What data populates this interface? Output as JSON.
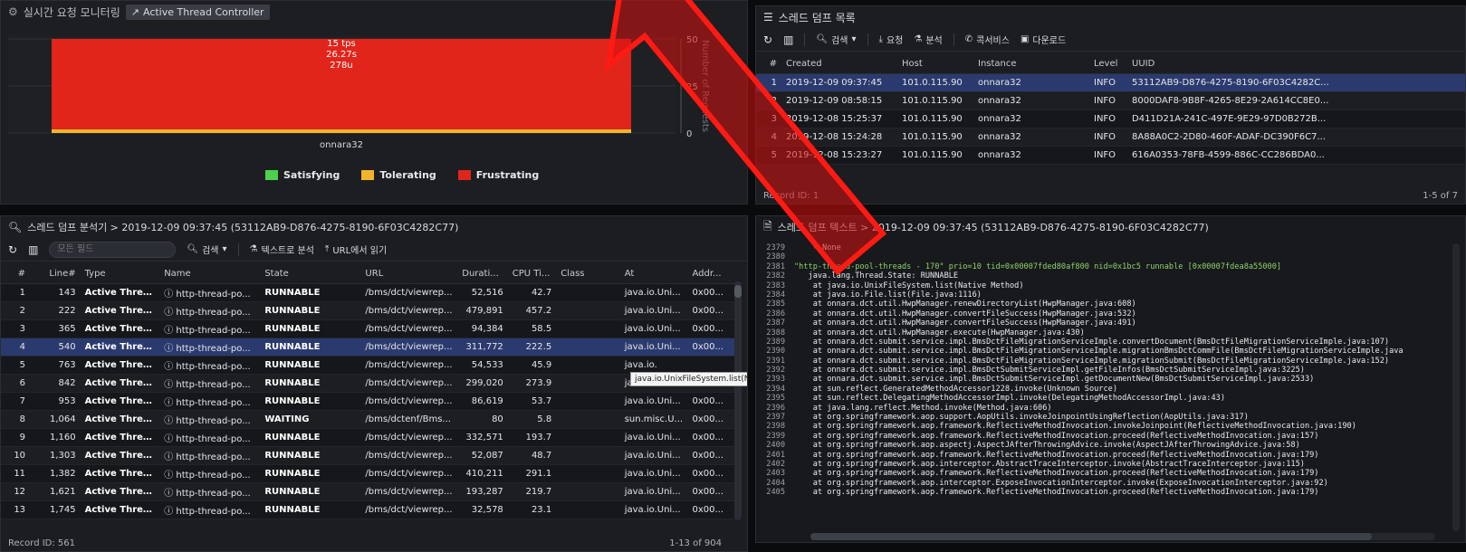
{
  "monitor": {
    "title": "실시간 요청 모니터링",
    "controller_button": "Active Thread Controller",
    "chart_label_rate": "15 tps",
    "chart_label_time": "26.27s",
    "chart_label_users": "278u",
    "chart_category": "onnara32",
    "chart_ylabel": "Number of Requests",
    "legend": [
      "Satisfying",
      "Tolerating",
      "Frustrating"
    ]
  },
  "chart_data": {
    "type": "bar",
    "categories": [
      "onnara32"
    ],
    "series": [
      {
        "name": "Satisfying",
        "values": [
          0
        ],
        "color": "#4bd14b"
      },
      {
        "name": "Tolerating",
        "values": [
          2
        ],
        "color": "#f2b52a"
      },
      {
        "name": "Frustrating",
        "values": [
          48
        ],
        "color": "#e1251b"
      }
    ],
    "ylabel": "Number of Requests",
    "yticks": [
      "0",
      "25",
      "50"
    ],
    "ylim": [
      0,
      50
    ],
    "legend_position": "bottom"
  },
  "dumplist": {
    "title": "스레드 덤프 목록",
    "toolbar": [
      "검색",
      "요청",
      "분석",
      "콕서비스",
      "다운로드"
    ],
    "columns": [
      "#",
      "Created",
      "Host",
      "Instance",
      "Level",
      "UUID"
    ],
    "rows": [
      {
        "n": "1",
        "created": "2019-12-09 09:37:45",
        "host": "101.0.115.90",
        "instance": "onnara32",
        "level": "INFO",
        "uuid": "53112AB9-D876-4275-8190-6F03C4282C..."
      },
      {
        "n": "2",
        "created": "2019-12-09 08:58:15",
        "host": "101.0.115.90",
        "instance": "onnara32",
        "level": "INFO",
        "uuid": "8000DAF8-9B8F-4265-8E29-2A614CC8E0..."
      },
      {
        "n": "3",
        "created": "2019-12-08 15:25:37",
        "host": "101.0.115.90",
        "instance": "onnara32",
        "level": "INFO",
        "uuid": "D411D21A-241C-497E-9E29-97D0B272B..."
      },
      {
        "n": "4",
        "created": "2019-12-08 15:24:28",
        "host": "101.0.115.90",
        "instance": "onnara32",
        "level": "INFO",
        "uuid": "8A88A0C2-2D80-460F-ADAF-DC390F6C7..."
      },
      {
        "n": "5",
        "created": "2019-12-08 15:23:27",
        "host": "101.0.115.90",
        "instance": "onnara32",
        "level": "INFO",
        "uuid": "616A0353-78FB-4599-886C-CC286BDA0..."
      }
    ],
    "record_id": "Record ID: 1",
    "page_info": "1-5 of 7"
  },
  "analyzer": {
    "title": "스레드 덤프 분석기 > 2019-12-09 09:37:45 (53112AB9-D876-4275-8190-6F03C4282C77)",
    "filter_placeholder": "모든 필드",
    "toolbar": [
      "검색",
      "텍스트로 분석",
      "URL에서 읽기"
    ],
    "columns": [
      "#",
      "Line#",
      "Type",
      "Name",
      "State",
      "URL",
      "Durati...",
      "CPU Ti...",
      "Class",
      "At",
      "Addr..."
    ],
    "rows": [
      {
        "n": "1",
        "line": "143",
        "type": "Active Thread",
        "name": "http-thread-po...",
        "state": "RUNNABLE",
        "url": "/bms/dct/viewrep...",
        "dur": "52,516",
        "cpu": "42.7",
        "cls": "",
        "at": "java.io.Uni...",
        "addr": "0x00..."
      },
      {
        "n": "2",
        "line": "222",
        "type": "Active Thread",
        "name": "http-thread-po...",
        "state": "RUNNABLE",
        "url": "/bms/dct/viewrep...",
        "dur": "479,891",
        "cpu": "457.2",
        "cls": "",
        "at": "java.io.Uni...",
        "addr": "0x00..."
      },
      {
        "n": "3",
        "line": "365",
        "type": "Active Thread",
        "name": "http-thread-po...",
        "state": "RUNNABLE",
        "url": "/bms/dct/viewrep...",
        "dur": "94,384",
        "cpu": "58.5",
        "cls": "",
        "at": "java.io.Uni...",
        "addr": "0x00..."
      },
      {
        "n": "4",
        "line": "540",
        "type": "Active Thread",
        "name": "http-thread-po...",
        "state": "RUNNABLE",
        "url": "/bms/dct/viewrep...",
        "dur": "311,772",
        "cpu": "222.5",
        "cls": "",
        "at": "java.io.Uni...",
        "addr": "0x00..."
      },
      {
        "n": "5",
        "line": "763",
        "type": "Active Thread",
        "name": "http-thread-po...",
        "state": "RUNNABLE",
        "url": "/bms/dct/viewrep...",
        "dur": "54,533",
        "cpu": "45.9",
        "cls": "",
        "at": "java.io.",
        "addr": ""
      },
      {
        "n": "6",
        "line": "842",
        "type": "Active Thread",
        "name": "http-thread-po...",
        "state": "RUNNABLE",
        "url": "/bms/dct/viewrep...",
        "dur": "299,020",
        "cpu": "273.9",
        "cls": "",
        "at": "java.io.Uni...",
        "addr": "0x00..."
      },
      {
        "n": "7",
        "line": "953",
        "type": "Active Thread",
        "name": "http-thread-po...",
        "state": "RUNNABLE",
        "url": "/bms/dct/viewrep...",
        "dur": "86,619",
        "cpu": "53.7",
        "cls": "",
        "at": "java.io.Uni...",
        "addr": "0x00..."
      },
      {
        "n": "8",
        "line": "1,064",
        "type": "Active Thread",
        "name": "http-thread-po...",
        "state": "WAITING",
        "url": "/bms/dctenf/Bms...",
        "dur": "80",
        "cpu": "5.8",
        "cls": "",
        "at": "sun.misc.U...",
        "addr": "0x00..."
      },
      {
        "n": "9",
        "line": "1,160",
        "type": "Active Thread",
        "name": "http-thread-po...",
        "state": "RUNNABLE",
        "url": "/bms/dct/viewrep...",
        "dur": "332,571",
        "cpu": "193.7",
        "cls": "",
        "at": "java.io.Uni...",
        "addr": "0x00..."
      },
      {
        "n": "10",
        "line": "1,303",
        "type": "Active Thread",
        "name": "http-thread-po...",
        "state": "RUNNABLE",
        "url": "/bms/dct/viewrep...",
        "dur": "52,087",
        "cpu": "48.7",
        "cls": "",
        "at": "java.io.Uni...",
        "addr": "0x00..."
      },
      {
        "n": "11",
        "line": "1,382",
        "type": "Active Thread",
        "name": "http-thread-po...",
        "state": "RUNNABLE",
        "url": "/bms/dct/viewrep...",
        "dur": "410,211",
        "cpu": "291.1",
        "cls": "",
        "at": "java.io.Uni...",
        "addr": "0x00..."
      },
      {
        "n": "12",
        "line": "1,621",
        "type": "Active Thread",
        "name": "http-thread-po...",
        "state": "RUNNABLE",
        "url": "/bms/dct/viewrep...",
        "dur": "193,287",
        "cpu": "219.7",
        "cls": "",
        "at": "java.io.Uni...",
        "addr": "0x00..."
      },
      {
        "n": "13",
        "line": "1,745",
        "type": "Active Thread",
        "name": "http-thread-po...",
        "state": "RUNNABLE",
        "url": "/bms/dct/viewrep...",
        "dur": "32,578",
        "cpu": "23.1",
        "cls": "",
        "at": "java.io.Uni...",
        "addr": "0x00..."
      }
    ],
    "tooltip": "java.io.UnixFileSystem.list(Native Method)",
    "record_id": "Record ID: 561",
    "page_info": "1-13 of 904"
  },
  "dumptext": {
    "title": "스레드 덤프 텍스트 > 2019-12-09 09:37:45 (53112AB9-D876-4275-8190-6F03C4282C77)",
    "lines": [
      {
        "n": "2379",
        "t": "    - None",
        "hl": false
      },
      {
        "n": "2380",
        "t": "",
        "hl": false
      },
      {
        "n": "2381",
        "t": "\"http-thread-pool-threads - 170\" prio=10 tid=0x00007fded80af800 nid=0x1bc5 runnable [0x00007fdea8a55000]",
        "hl": true
      },
      {
        "n": "2382",
        "t": "   java.lang.Thread.State: RUNNABLE",
        "hl": false
      },
      {
        "n": "2383",
        "t": "    at java.io.UnixFileSystem.list(Native Method)",
        "hl": false
      },
      {
        "n": "2384",
        "t": "    at java.io.File.list(File.java:1116)",
        "hl": false
      },
      {
        "n": "2385",
        "t": "    at onnara.dct.util.HwpManager.renewDirectoryList(HwpManager.java:608)",
        "hl": false
      },
      {
        "n": "2386",
        "t": "    at onnara.dct.util.HwpManager.convertFileSuccess(HwpManager.java:532)",
        "hl": false
      },
      {
        "n": "2387",
        "t": "    at onnara.dct.util.HwpManager.convertFileSuccess(HwpManager.java:491)",
        "hl": false
      },
      {
        "n": "2388",
        "t": "    at onnara.dct.util.HwpManager.execute(HwpManager.java:430)",
        "hl": false
      },
      {
        "n": "2389",
        "t": "    at onnara.dct.submit.service.impl.BmsDctFileMigrationServiceImple.convertDocument(BmsDctFileMigrationServiceImple.java:107)",
        "hl": false
      },
      {
        "n": "2390",
        "t": "    at onnara.dct.submit.service.impl.BmsDctFileMigrationServiceImple.migrationBmsDctCommFile(BmsDctFileMigrationServiceImple.java",
        "hl": false
      },
      {
        "n": "2391",
        "t": "    at onnara.dct.submit.service.impl.BmsDctFileMigrationServiceImple.migrationSubmit(BmsDctFileMigrationServiceImple.java:152)",
        "hl": false
      },
      {
        "n": "2392",
        "t": "    at onnara.dct.submit.service.impl.BmsDctSubmitServiceImpl.getFileInfos(BmsDctSubmitServiceImpl.java:3225)",
        "hl": false
      },
      {
        "n": "2393",
        "t": "    at onnara.dct.submit.service.impl.BmsDctSubmitServiceImpl.getDocumentNew(BmsDctSubmitServiceImpl.java:2533)",
        "hl": false
      },
      {
        "n": "2394",
        "t": "    at sun.reflect.GeneratedMethodAccessor1228.invoke(Unknown Source)",
        "hl": false
      },
      {
        "n": "2395",
        "t": "    at sun.reflect.DelegatingMethodAccessorImpl.invoke(DelegatingMethodAccessorImpl.java:43)",
        "hl": false
      },
      {
        "n": "2396",
        "t": "    at java.lang.reflect.Method.invoke(Method.java:606)",
        "hl": false
      },
      {
        "n": "2397",
        "t": "    at org.springframework.aop.support.AopUtils.invokeJoinpointUsingReflection(AopUtils.java:317)",
        "hl": false
      },
      {
        "n": "2398",
        "t": "    at org.springframework.aop.framework.ReflectiveMethodInvocation.invokeJoinpoint(ReflectiveMethodInvocation.java:190)",
        "hl": false
      },
      {
        "n": "2399",
        "t": "    at org.springframework.aop.framework.ReflectiveMethodInvocation.proceed(ReflectiveMethodInvocation.java:157)",
        "hl": false
      },
      {
        "n": "2400",
        "t": "    at org.springframework.aop.aspectj.AspectJAfterThrowingAdvice.invoke(AspectJAfterThrowingAdvice.java:58)",
        "hl": false
      },
      {
        "n": "2401",
        "t": "    at org.springframework.aop.framework.ReflectiveMethodInvocation.proceed(ReflectiveMethodInvocation.java:179)",
        "hl": false
      },
      {
        "n": "2402",
        "t": "    at org.springframework.aop.interceptor.AbstractTraceInterceptor.invoke(AbstractTraceInterceptor.java:115)",
        "hl": false
      },
      {
        "n": "2403",
        "t": "    at org.springframework.aop.framework.ReflectiveMethodInvocation.proceed(ReflectiveMethodInvocation.java:179)",
        "hl": false
      },
      {
        "n": "2404",
        "t": "    at org.springframework.aop.interceptor.ExposeInvocationInterceptor.invoke(ExposeInvocationInterceptor.java:92)",
        "hl": false
      },
      {
        "n": "2405",
        "t": "    at org.springframework.aop.framework.ReflectiveMethodInvocation.proceed(ReflectiveMethodInvocation.java:179)",
        "hl": false
      }
    ]
  },
  "overlay": {
    "arrow_color": "#d8110f"
  }
}
